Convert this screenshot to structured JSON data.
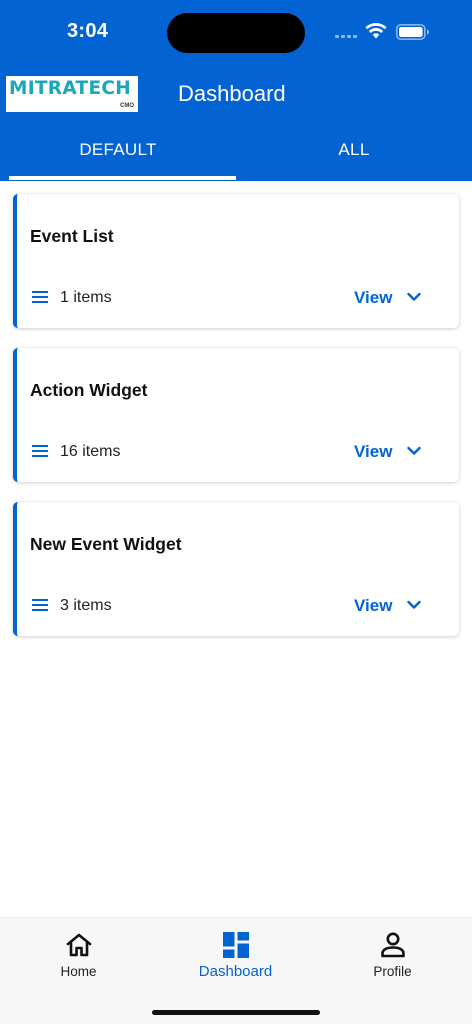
{
  "status_bar": {
    "time": "3:04"
  },
  "app_bar": {
    "logo_text": "MITRATECH",
    "logo_subtext": "CMO",
    "title": "Dashboard"
  },
  "tabs": [
    {
      "label": "DEFAULT",
      "selected": true
    },
    {
      "label": "ALL",
      "selected": false
    }
  ],
  "widgets": [
    {
      "title": "Event List",
      "count": "1 items",
      "action": "View"
    },
    {
      "title": "Action Widget",
      "count": "16 items",
      "action": "View"
    },
    {
      "title": "New Event Widget",
      "count": "3 items",
      "action": "View"
    }
  ],
  "bottom_nav": [
    {
      "label": "Home",
      "icon": "home-icon",
      "selected": false
    },
    {
      "label": "Dashboard",
      "icon": "dashboard-icon",
      "selected": true
    },
    {
      "label": "Profile",
      "icon": "person-icon",
      "selected": false
    }
  ],
  "colors": {
    "primary": "#0463d2",
    "logo_teal": "#1aa7b8",
    "background": "#ffffff",
    "nav_background": "#f7f7f7"
  }
}
